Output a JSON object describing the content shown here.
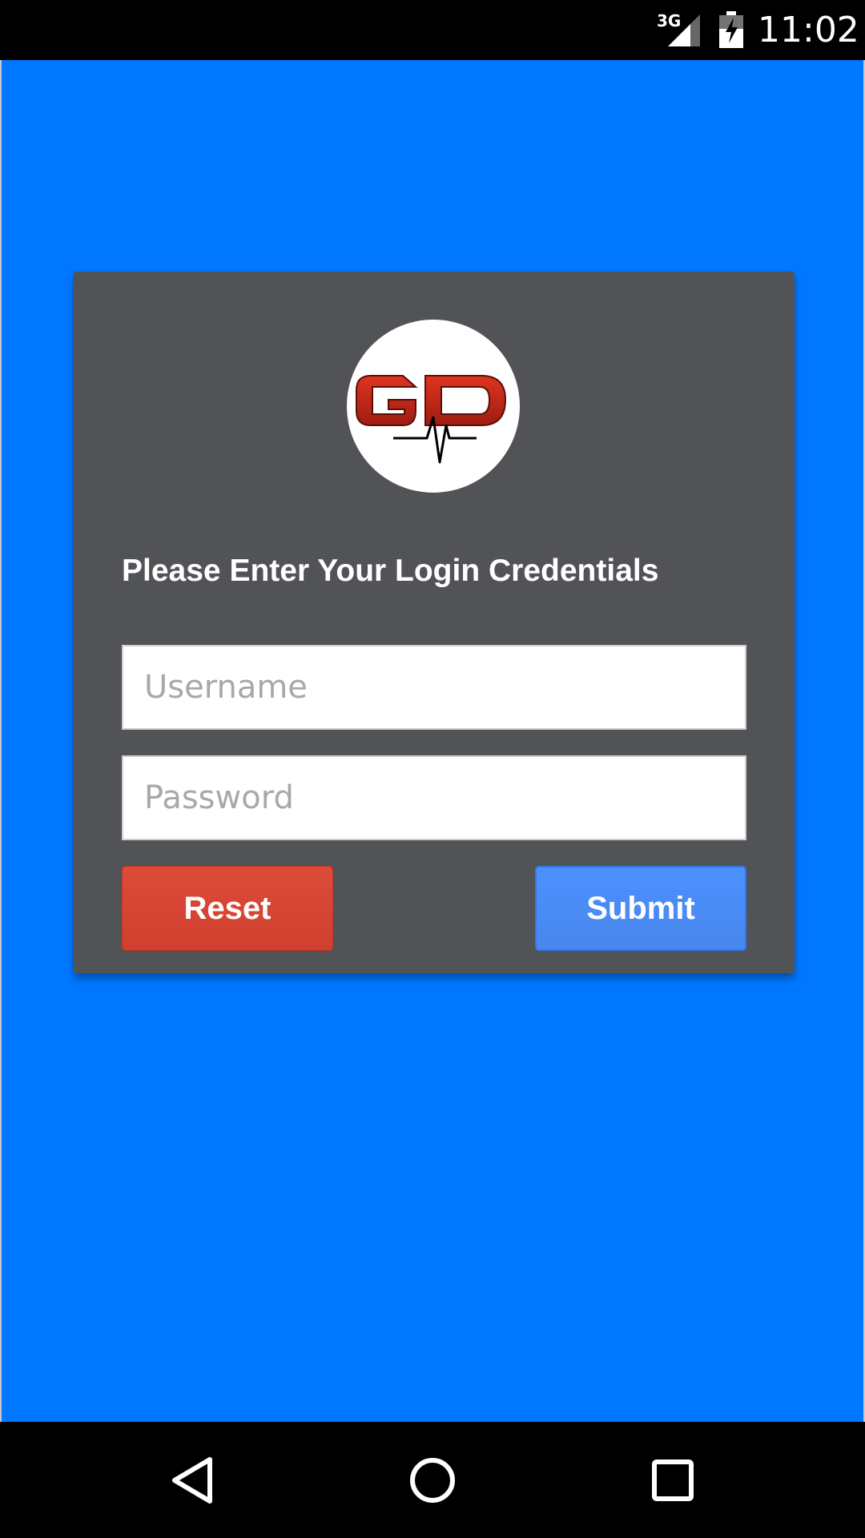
{
  "status_bar": {
    "network_type": "3G",
    "time": "11:02",
    "icons": [
      "signal-icon",
      "battery-charging-icon"
    ]
  },
  "login": {
    "logo_text": "GD",
    "prompt": "Please Enter Your Login Credentials",
    "username_placeholder": "Username",
    "username_value": "",
    "password_placeholder": "Password",
    "password_value": "",
    "reset_label": "Reset",
    "submit_label": "Submit"
  },
  "nav_bar": {
    "icons": [
      "back-icon",
      "home-icon",
      "recents-icon"
    ]
  },
  "colors": {
    "background": "#0077ff",
    "card": "#525357",
    "reset_button": "#dd4b39",
    "submit_button": "#4d90fe",
    "logo_red": "#c0271b"
  }
}
